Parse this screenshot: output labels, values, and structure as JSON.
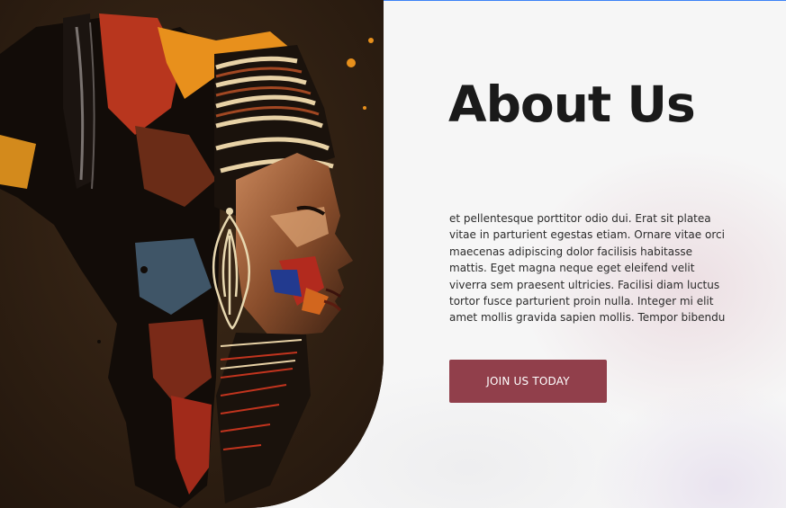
{
  "about": {
    "title": "About Us",
    "body": "et pellentesque porttitor odio dui. Erat sit platea vitae in parturient egestas etiam. Ornare vitae orci maecenas adipiscing dolor facilisis habitasse mattis. Eget magna neque eget eleifend velit viverra sem praesent ultricies. Facilisi diam luctus tortor fusce parturient proin nulla. Integer mi elit amet mollis gravida sapien mollis. Tempor bibendu",
    "cta_label": "JOIN US TODAY"
  },
  "colors": {
    "accent": "#913f4b",
    "heading": "#1a1a1a",
    "background": "#f6f6f6"
  },
  "image": {
    "semantic": "african-woman-profile-map-artwork"
  }
}
